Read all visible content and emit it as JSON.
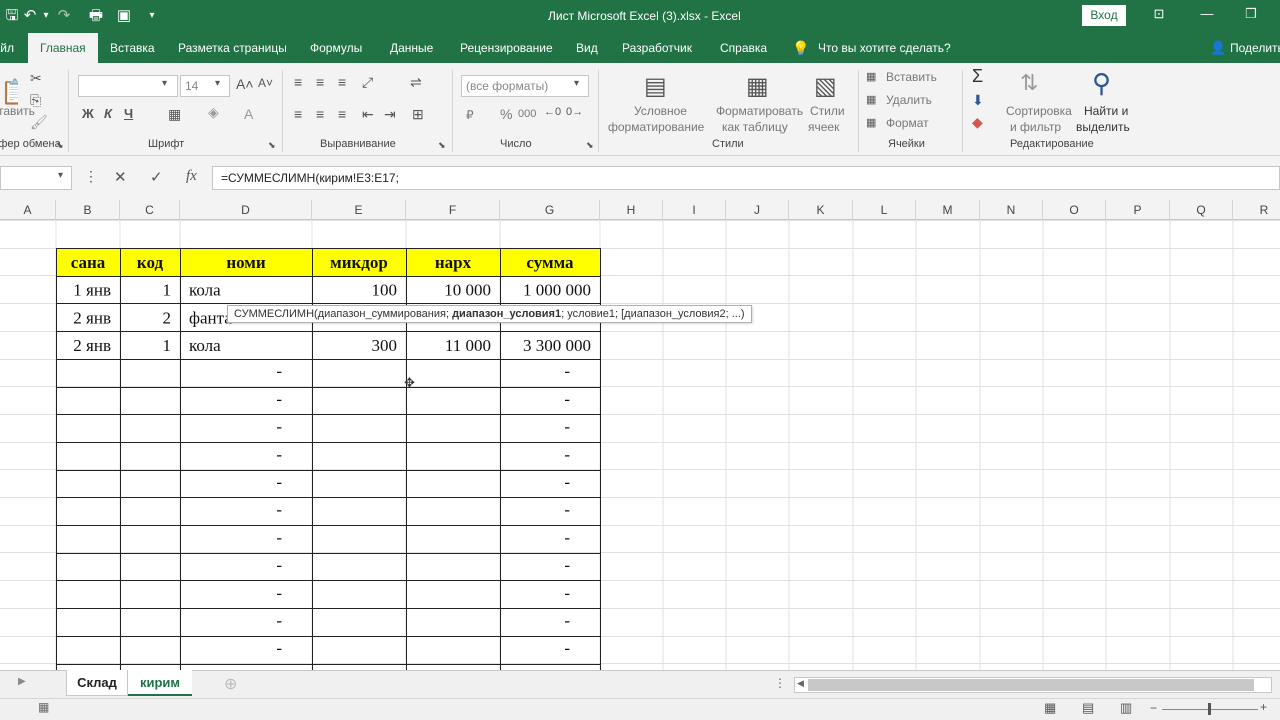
{
  "titlebar": {
    "title": "Лист Microsoft Excel (3).xlsx  -  Excel",
    "signin": "Вход",
    "bg": "#217346"
  },
  "tabs": [
    "Файл",
    "Главная",
    "Вставка",
    "Разметка страницы",
    "Формулы",
    "Данные",
    "Рецензирование",
    "Вид",
    "Разработчик",
    "Справка"
  ],
  "tell_me": "Что вы хотите сделать?",
  "share": "Поделиться",
  "ribbon": {
    "groups": {
      "clipboard": "Буфер обмена",
      "font": "Шрифт",
      "alignment": "Выравнивание",
      "number": "Число",
      "styles": "Стили",
      "cells": "Ячейки",
      "editing": "Редактирование"
    },
    "paste": "Вставить",
    "font_name": "",
    "font_size": "14",
    "bold": "Ж",
    "italic": "К",
    "underline": "Ч",
    "number_format": "(все форматы)",
    "currency": "₽",
    "percent": "%",
    "thousands": "000",
    "cond_format_1": "Условное",
    "cond_format_2": "форматирование",
    "format_table_1": "Форматировать",
    "format_table_2": "как таблицу",
    "cell_styles_1": "Стили",
    "cell_styles_2": "ячеек",
    "insert": "Вставить",
    "delete": "Удалить",
    "format": "Формат",
    "sort_1": "Сортировка",
    "sort_2": "и фильтр",
    "find_1": "Найти и",
    "find_2": "выделить"
  },
  "formula_bar": {
    "name_box": "",
    "formula": "=СУММЕСЛИМН(кирим!E3:E17;",
    "fx": "fx"
  },
  "columns": [
    "A",
    "B",
    "C",
    "D",
    "E",
    "F",
    "G",
    "H",
    "I",
    "J",
    "K",
    "L",
    "M",
    "N",
    "O",
    "P",
    "Q",
    "R"
  ],
  "table": {
    "headers": [
      "сана",
      "код",
      "номи",
      "микдор",
      "нарх",
      "сумма"
    ],
    "rows": [
      [
        "1 янв",
        "1",
        "кола",
        "100",
        "10 000",
        "1 000 000"
      ],
      [
        "2 янв",
        "2",
        "фанта",
        "",
        "",
        ""
      ],
      [
        "2 янв",
        "1",
        "кола",
        "300",
        "11 000",
        "3 300 000"
      ]
    ],
    "dash": "-",
    "header_bg": "#ffff00"
  },
  "tooltip": {
    "prefix": "СУММЕСЛИМН(диапазон_суммирования; ",
    "bold": "диапазон_условия1",
    "suffix": "; условие1; [диапазон_условия2; ...)"
  },
  "sheets": [
    "Склад",
    "кирим"
  ],
  "active_sheet": "кирим"
}
